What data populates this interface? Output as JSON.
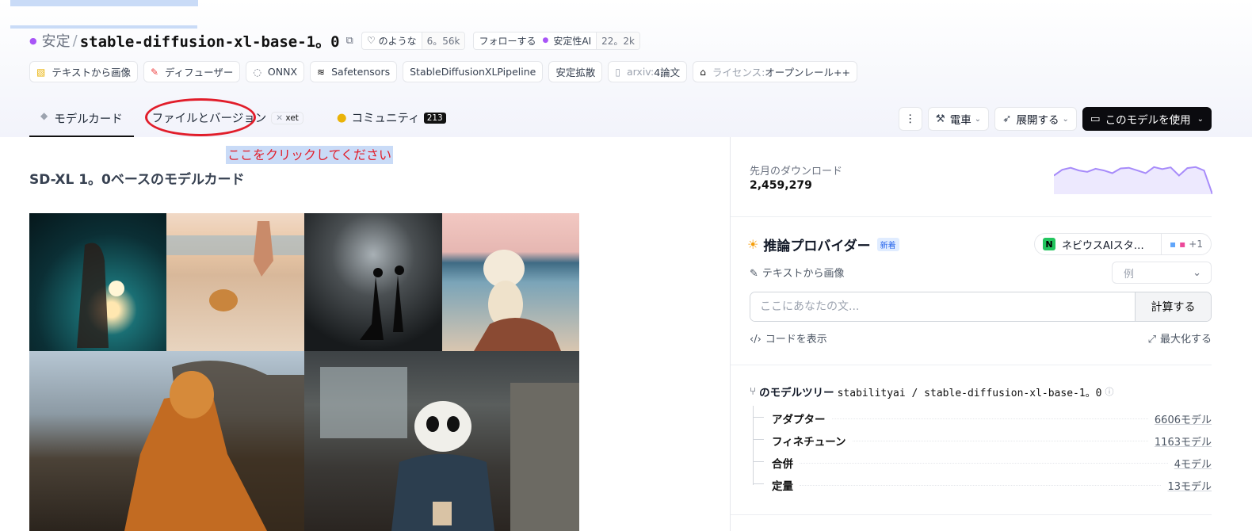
{
  "repo": {
    "org": "安定",
    "separator": "/",
    "name": "stable-diffusion-xl-base-1。0",
    "like_label": "のような",
    "like_count": "6。56k",
    "follow_label": "フォローする",
    "follow_org": "安定性AI",
    "follow_count": "22。2k"
  },
  "tags": [
    {
      "icon": "text-to-image-icon",
      "label": "テキストから画像"
    },
    {
      "icon": "brush-icon",
      "label": "ディフューザー"
    },
    {
      "icon": "onnx-icon",
      "label": "ONNX"
    },
    {
      "icon": "safetensors-icon",
      "label": "Safetensors"
    },
    {
      "icon": "",
      "label": "StableDiffusionXLPipeline"
    },
    {
      "icon": "",
      "label": "安定拡散"
    },
    {
      "icon": "paper-icon",
      "label_muted": "arxiv:",
      "label": "4論文"
    },
    {
      "icon": "bank-icon",
      "label_muted": "ライセンス: ",
      "label": "オープンレール++"
    }
  ],
  "tabs": {
    "model_card": "モデルカード",
    "files": "ファイルとバージョン",
    "xet": "xet",
    "community": "コミュニティ",
    "community_count": "213"
  },
  "actions": {
    "more": "⋮",
    "train": "電車",
    "deploy": "展開する",
    "use_model": "このモデルを使用"
  },
  "annotation": {
    "click_here": "ここをクリックしてください"
  },
  "main": {
    "title": "SD-XL 1。0ベースのモデルカード"
  },
  "downloads": {
    "label": "先月のダウンロード",
    "value": "2,459,279",
    "spark": [
      0.55,
      0.72,
      0.78,
      0.7,
      0.66,
      0.75,
      0.7,
      0.62,
      0.76,
      0.78,
      0.7,
      0.62,
      0.8,
      0.74,
      0.79,
      0.55,
      0.77,
      0.8,
      0.7,
      0.0
    ]
  },
  "inference": {
    "title": "推論プロバイダー",
    "new_badge": "新着",
    "provider": "ネビウスAIスタ…",
    "provider_more": "+1",
    "task": "テキストから画像",
    "example": "例",
    "input_placeholder": "ここにあなたの文...",
    "compute": "計算する",
    "show_code": "コードを表示",
    "maximize": "最大化する"
  },
  "tree": {
    "title_label": "のモデルツリー",
    "path": "stabilityai / stable-diffusion-xl-base-1。0",
    "rows": [
      {
        "label": "アダプター",
        "value": "6606モデル"
      },
      {
        "label": "フィネチューン",
        "value": "1163モデル"
      },
      {
        "label": "合併",
        "value": "4モデル"
      },
      {
        "label": "定量",
        "value": "13モデル"
      }
    ]
  },
  "colors": {
    "accent_purple": "#a78bfa",
    "annotation_red": "#e11d2a",
    "highlight_blue": "#c9dbf7"
  }
}
